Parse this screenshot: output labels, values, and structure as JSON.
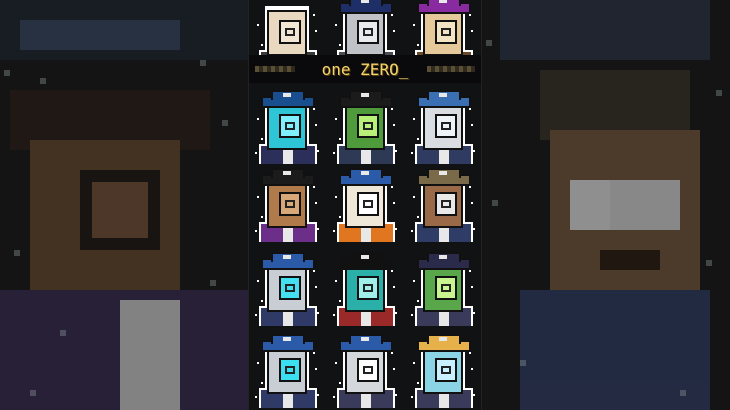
{
  "title": {
    "text": "one ZERO_"
  },
  "colors": {
    "background": "#0b0b0d",
    "title_text": "#f3d36b",
    "outline": "#ffffff"
  },
  "grid": {
    "columns": 3,
    "characters": [
      {
        "name": "bald-pale-character",
        "skin": "#e9d9c0",
        "hat": "none",
        "visor": "#f2e7d3",
        "body": "#3a3a3a"
      },
      {
        "name": "navy-captain-character",
        "skin": "#bfc3c8",
        "hat": "#1e2e66",
        "visor": "#e7ebef",
        "body": "#4a4f57"
      },
      {
        "name": "purple-hair-character",
        "skin": "#e6c99a",
        "hat": "#8a2aa0",
        "visor": "#f4e4c4",
        "body": "#6a4a2a"
      },
      {
        "name": "cyan-diver-character",
        "skin": "#2ec5d7",
        "hat": "#1a4f8f",
        "visor": "#7ff0ff",
        "body": "#2b2f5a"
      },
      {
        "name": "green-pirate-character",
        "skin": "#4f9a3a",
        "hat": "#1b1b1b",
        "visor": "#b8f07a",
        "body": "#2e3a55"
      },
      {
        "name": "silver-helmet-character",
        "skin": "#d9dde2",
        "hat": "#3a6fb3",
        "visor": "#eef3f8",
        "body": "#2f3b60"
      },
      {
        "name": "tan-tricorn-character",
        "skin": "#b07a4a",
        "hat": "#1b1b1b",
        "visor": "#d9a878",
        "body": "#6b2f8a"
      },
      {
        "name": "sailor-white-character",
        "skin": "#efe7d8",
        "hat": "#2a5aa8",
        "visor": "#ffffff",
        "body": "#e0761f"
      },
      {
        "name": "brown-cowboy-character",
        "skin": "#9a6a48",
        "hat": "#7a6a4a",
        "visor": "#e9e9e9",
        "body": "#2f3d66"
      },
      {
        "name": "cyan-navy-character",
        "skin": "#c9ced4",
        "hat": "#2a5aa8",
        "visor": "#44e0f0",
        "body": "#2f3b66"
      },
      {
        "name": "teal-pirate-character",
        "skin": "#2ab0a8",
        "hat": "#111111",
        "visor": "#9ff0ea",
        "body": "#9a2a2a"
      },
      {
        "name": "green-captain-character",
        "skin": "#5aa64a",
        "hat": "#2a2a4a",
        "visor": "#c8f590",
        "body": "#3a3a5a"
      },
      {
        "name": "blue-sailor-character",
        "skin": "#c9ced4",
        "hat": "#2a5aa8",
        "visor": "#3ae0f0",
        "body": "#2f3b66"
      },
      {
        "name": "grey-admiral-character",
        "skin": "#d4d7db",
        "hat": "#2a5aa8",
        "visor": "#ffffff",
        "body": "#3a3a5a"
      },
      {
        "name": "rainbow-hat-character",
        "skin": "#8ad4e6",
        "hat": "#e6b04a",
        "visor": "#c8f0ff",
        "body": "#3a3a5a"
      }
    ]
  }
}
